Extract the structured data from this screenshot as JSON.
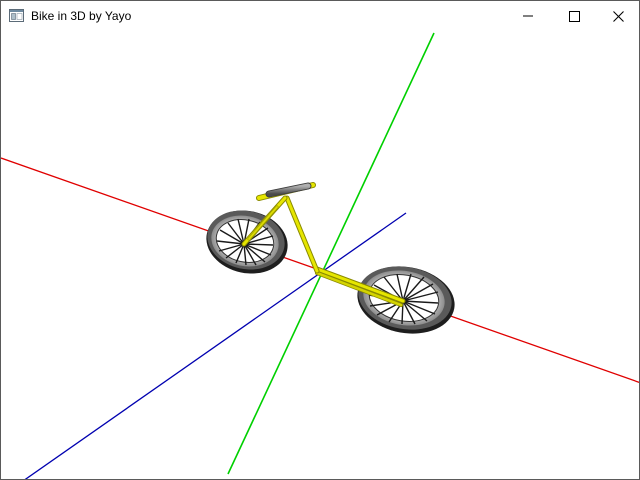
{
  "window": {
    "title": "Bike in 3D by Yayo",
    "icon": "application-window-icon",
    "buttons": {
      "minimize": "minimize-icon",
      "maximize": "maximize-icon",
      "close": "close-icon"
    }
  },
  "scene": {
    "axis_colors": {
      "x_axis": "#e00000",
      "y_axis": "#00d000",
      "z_axis": "#0000b0"
    },
    "frame_color": "#d8d800",
    "tire_color": "#2a2a2a",
    "rim_color": "#d8d8d8",
    "handlebar_grip_color": "#7a7a7a"
  }
}
